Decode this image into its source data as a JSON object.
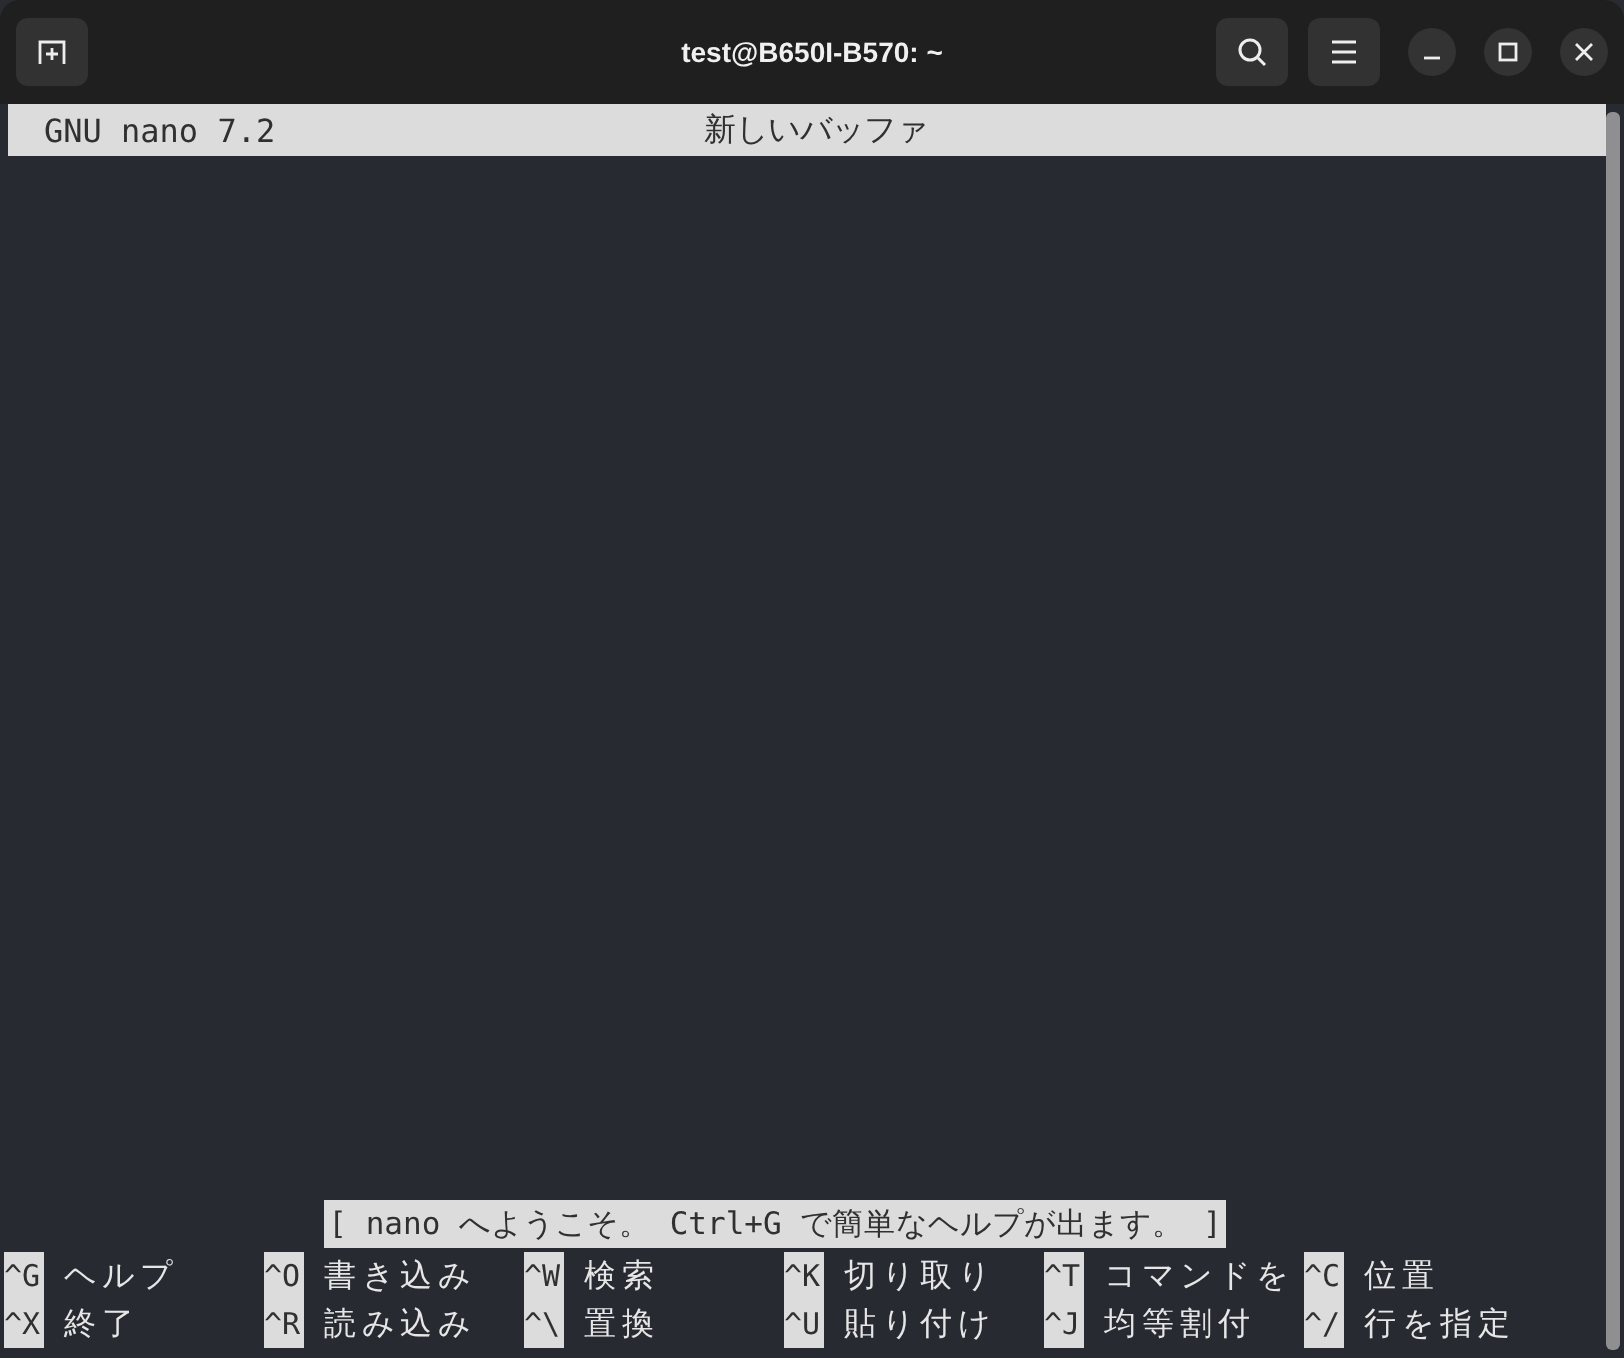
{
  "window": {
    "title": "test@B650I-B570: ~"
  },
  "nano": {
    "version": "GNU nano 7.2",
    "buffer_name": "新しいバッファ"
  },
  "status_message": "[ nano へようこそ。 Ctrl+G で簡単なヘルプが出ます。 ]",
  "shortcuts": [
    [
      {
        "key": "^G",
        "label": "ヘルプ"
      },
      {
        "key": "^O",
        "label": "書き込み"
      },
      {
        "key": "^W",
        "label": "検索"
      },
      {
        "key": "^K",
        "label": "切り取り"
      },
      {
        "key": "^T",
        "label": "コマンドを"
      },
      {
        "key": "^C",
        "label": "位置"
      }
    ],
    [
      {
        "key": "^X",
        "label": "終了"
      },
      {
        "key": "^R",
        "label": "読み込み"
      },
      {
        "key": "^\\",
        "label": "置換"
      },
      {
        "key": "^U",
        "label": "貼り付け"
      },
      {
        "key": "^J",
        "label": "均等割付"
      },
      {
        "key": "^/",
        "label": "行を指定"
      }
    ]
  ]
}
